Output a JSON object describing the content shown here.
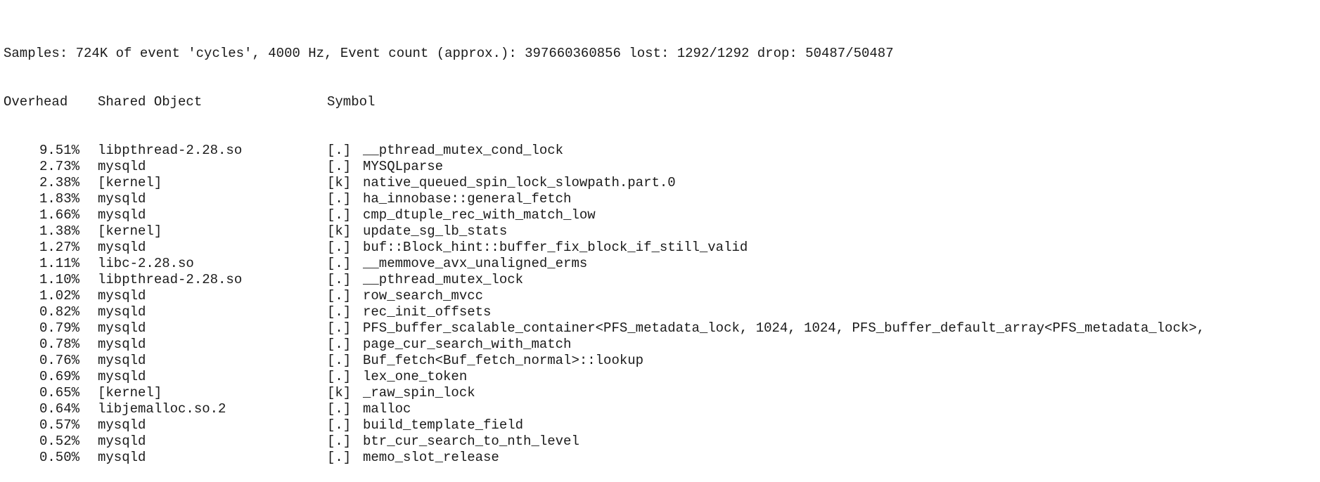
{
  "summary": "Samples: 724K of event 'cycles', 4000 Hz, Event count (approx.): 397660360856 lost: 1292/1292 drop: 50487/50487",
  "columns": {
    "overhead": "Overhead",
    "shared_object": "Shared Object",
    "symbol": "Symbol"
  },
  "rows": [
    {
      "overhead": "9.51%",
      "object": "libpthread-2.28.so",
      "prio": "[.]",
      "symbol": "__pthread_mutex_cond_lock"
    },
    {
      "overhead": "2.73%",
      "object": "mysqld",
      "prio": "[.]",
      "symbol": "MYSQLparse"
    },
    {
      "overhead": "2.38%",
      "object": "[kernel]",
      "prio": "[k]",
      "symbol": "native_queued_spin_lock_slowpath.part.0"
    },
    {
      "overhead": "1.83%",
      "object": "mysqld",
      "prio": "[.]",
      "symbol": "ha_innobase::general_fetch"
    },
    {
      "overhead": "1.66%",
      "object": "mysqld",
      "prio": "[.]",
      "symbol": "cmp_dtuple_rec_with_match_low"
    },
    {
      "overhead": "1.38%",
      "object": "[kernel]",
      "prio": "[k]",
      "symbol": "update_sg_lb_stats"
    },
    {
      "overhead": "1.27%",
      "object": "mysqld",
      "prio": "[.]",
      "symbol": "buf::Block_hint::buffer_fix_block_if_still_valid"
    },
    {
      "overhead": "1.11%",
      "object": "libc-2.28.so",
      "prio": "[.]",
      "symbol": "__memmove_avx_unaligned_erms"
    },
    {
      "overhead": "1.10%",
      "object": "libpthread-2.28.so",
      "prio": "[.]",
      "symbol": "__pthread_mutex_lock"
    },
    {
      "overhead": "1.02%",
      "object": "mysqld",
      "prio": "[.]",
      "symbol": "row_search_mvcc"
    },
    {
      "overhead": "0.82%",
      "object": "mysqld",
      "prio": "[.]",
      "symbol": "rec_init_offsets"
    },
    {
      "overhead": "0.79%",
      "object": "mysqld",
      "prio": "[.]",
      "symbol": "PFS_buffer_scalable_container<PFS_metadata_lock, 1024, 1024, PFS_buffer_default_array<PFS_metadata_lock>,"
    },
    {
      "overhead": "0.78%",
      "object": "mysqld",
      "prio": "[.]",
      "symbol": "page_cur_search_with_match"
    },
    {
      "overhead": "0.76%",
      "object": "mysqld",
      "prio": "[.]",
      "symbol": "Buf_fetch<Buf_fetch_normal>::lookup"
    },
    {
      "overhead": "0.69%",
      "object": "mysqld",
      "prio": "[.]",
      "symbol": "lex_one_token"
    },
    {
      "overhead": "0.65%",
      "object": "[kernel]",
      "prio": "[k]",
      "symbol": "_raw_spin_lock"
    },
    {
      "overhead": "0.64%",
      "object": "libjemalloc.so.2",
      "prio": "[.]",
      "symbol": "malloc"
    },
    {
      "overhead": "0.57%",
      "object": "mysqld",
      "prio": "[.]",
      "symbol": "build_template_field"
    },
    {
      "overhead": "0.52%",
      "object": "mysqld",
      "prio": "[.]",
      "symbol": "btr_cur_search_to_nth_level"
    },
    {
      "overhead": "0.50%",
      "object": "mysqld",
      "prio": "[.]",
      "symbol": "memo_slot_release"
    }
  ]
}
